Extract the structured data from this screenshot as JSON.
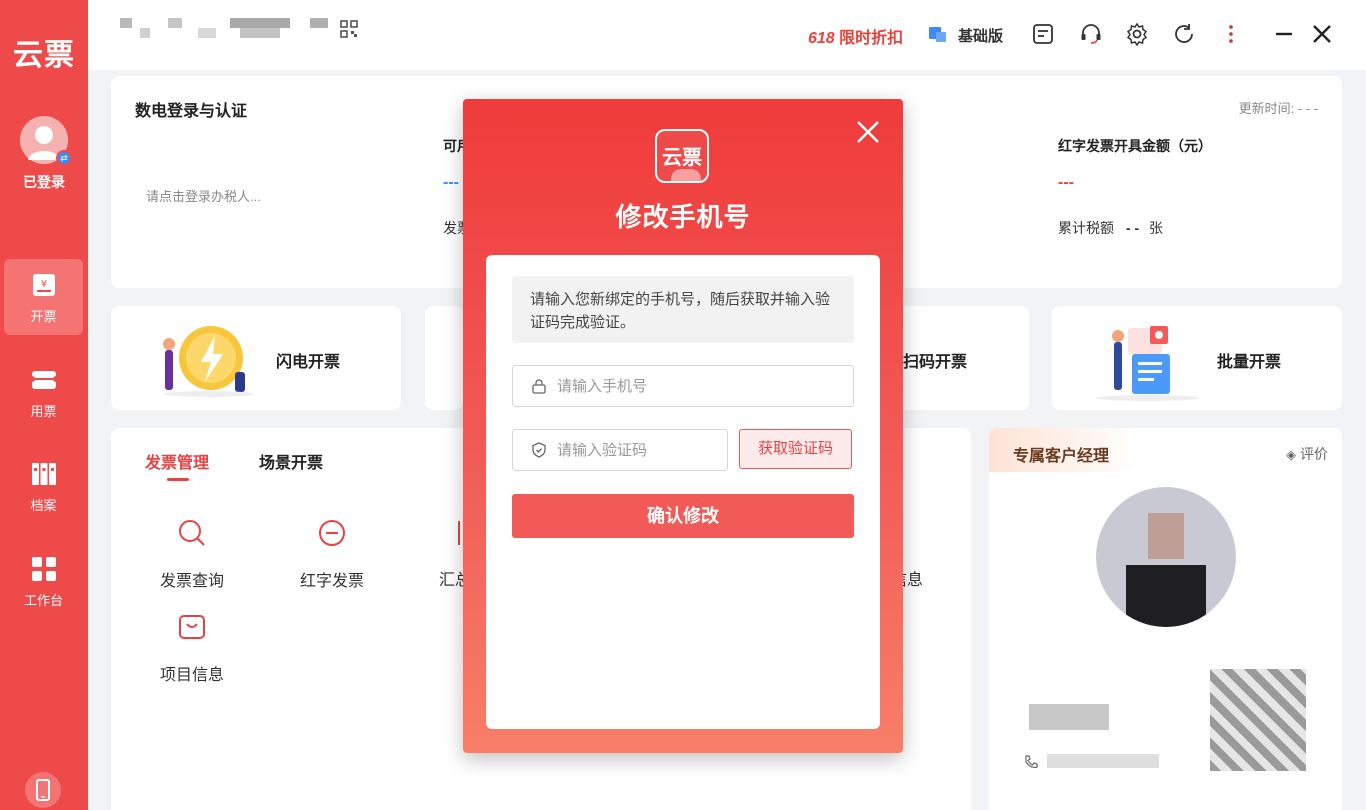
{
  "app": {
    "logo": "云票"
  },
  "sidebar": {
    "login_status": "已登录",
    "items": [
      {
        "label": "开票",
        "icon": "invoice-icon",
        "active": true
      },
      {
        "label": "用票",
        "icon": "ticket-icon",
        "active": false
      },
      {
        "label": "档案",
        "icon": "archive-icon",
        "active": false
      },
      {
        "label": "工作台",
        "icon": "grid-icon",
        "active": false
      }
    ]
  },
  "topbar": {
    "promo_prefix": "618",
    "promo_text": "限时折扣",
    "edition": "基础版"
  },
  "auth_card": {
    "title": "数电登录与认证",
    "update_time_label": "更新时间: - - -",
    "login_prompt": "请点击登录办税人...",
    "col1_head": "可用",
    "col1_value": "---",
    "col1_sub": "发票",
    "red_title": "红字发票开具金额（元）",
    "red_value": "---",
    "tax_label": "累计税额",
    "tax_value": "-   -",
    "tax_unit": "张"
  },
  "quick_actions": [
    {
      "label": "闪电开票"
    },
    {
      "label": "扫码开票"
    },
    {
      "label": "批量开票"
    }
  ],
  "management": {
    "tabs": [
      "发票管理",
      "场景开票"
    ],
    "functions": [
      {
        "label": "发票查询",
        "icon": "search-icon"
      },
      {
        "label": "红字发票",
        "icon": "minus-circle-icon"
      },
      {
        "label": "汇总",
        "icon": "summary-icon"
      },
      {
        "label": "信息",
        "icon": "info-icon"
      },
      {
        "label": "项目信息",
        "icon": "bag-icon"
      }
    ]
  },
  "manager": {
    "title": "专属客户经理",
    "rate": "评价"
  },
  "modal": {
    "logo": "云票",
    "title": "修改手机号",
    "hint": "请输入您新绑定的手机号，随后获取并输入验证码完成验证。",
    "phone_placeholder": "请输入手机号",
    "code_placeholder": "请输入验证码",
    "get_code": "获取验证码",
    "confirm": "确认修改"
  },
  "colors": {
    "brand": "#ee4a4a",
    "accent": "#f25a58"
  }
}
